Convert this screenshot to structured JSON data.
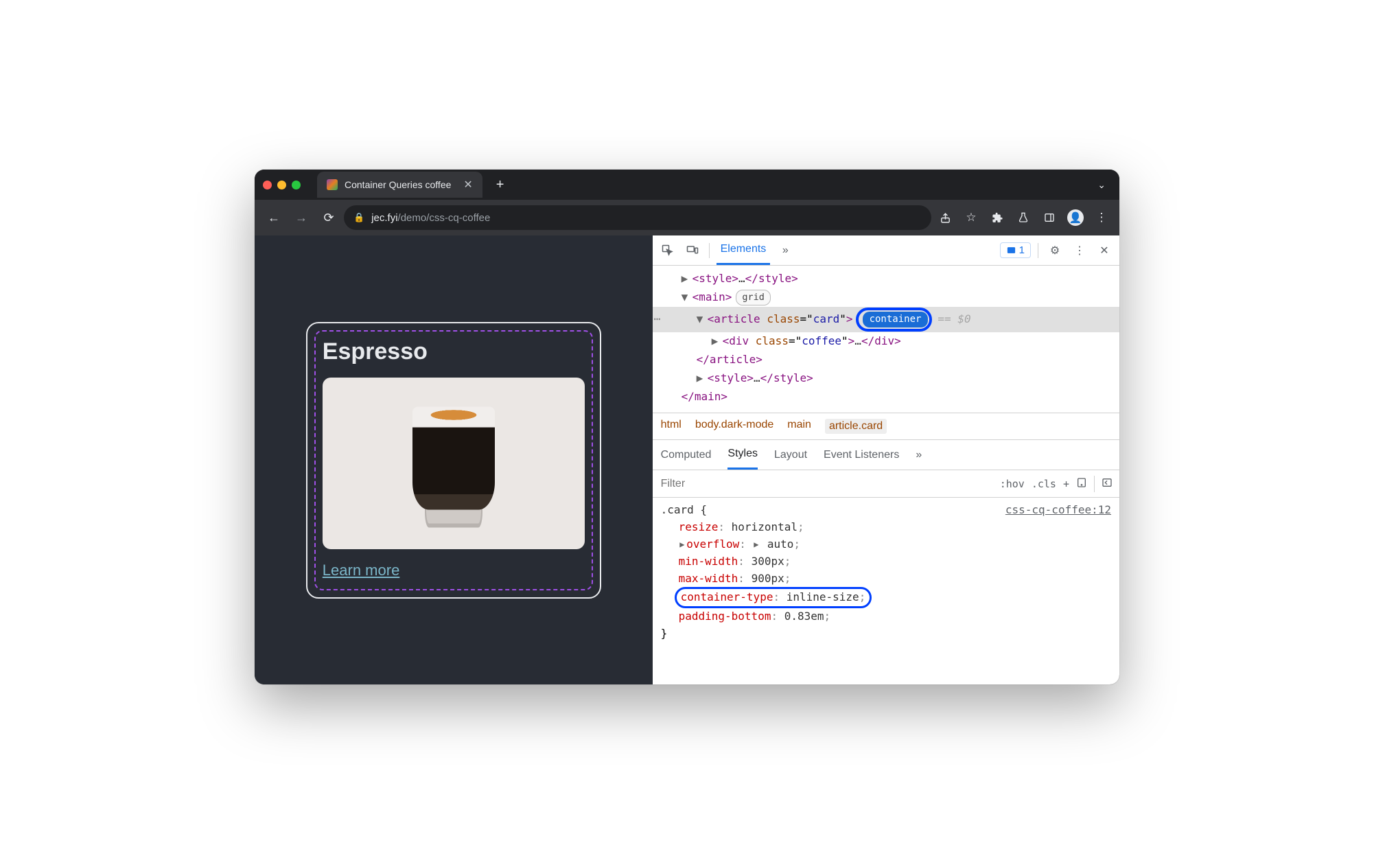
{
  "tab": {
    "title": "Container Queries coffee"
  },
  "url": {
    "domain": "jec.fyi",
    "path": "/demo/css-cq-coffee"
  },
  "page": {
    "card_title": "Espresso",
    "learn_more": "Learn more"
  },
  "devtools": {
    "toolbar": {
      "elements_tab": "Elements",
      "issues_count": "1"
    },
    "dom": {
      "style_open": "<style>",
      "style_close": "</style>",
      "ellipsis": "…",
      "main_open": "<main>",
      "main_close": "</main>",
      "grid_badge": "grid",
      "article_open_tag": "article",
      "article_attr_name": "class",
      "article_attr_val": "card",
      "container_badge": "container",
      "eq0": "== $0",
      "div_open_tag": "div",
      "div_attr_name": "class",
      "div_attr_val": "coffee",
      "div_close": "</div>",
      "article_close": "</article>"
    },
    "breadcrumb": {
      "html": "html",
      "body": "body.dark-mode",
      "main": "main",
      "article": "article.card"
    },
    "styles_tabs": {
      "computed": "Computed",
      "styles": "Styles",
      "layout": "Layout",
      "event": "Event Listeners",
      "more": "»"
    },
    "filter": {
      "placeholder": "Filter",
      "hov": ":hov",
      "cls": ".cls",
      "plus": "+"
    },
    "rule": {
      "selector": ".card {",
      "source": "css-cq-coffee:12",
      "close": "}",
      "props": [
        {
          "name": "resize",
          "value": "horizontal",
          "shorthand": false
        },
        {
          "name": "overflow",
          "value": "auto",
          "shorthand": true
        },
        {
          "name": "min-width",
          "value": "300px",
          "shorthand": false
        },
        {
          "name": "max-width",
          "value": "900px",
          "shorthand": false
        },
        {
          "name": "container-type",
          "value": "inline-size",
          "shorthand": false,
          "highlight": true
        },
        {
          "name": "padding-bottom",
          "value": "0.83em",
          "shorthand": false
        }
      ]
    }
  }
}
